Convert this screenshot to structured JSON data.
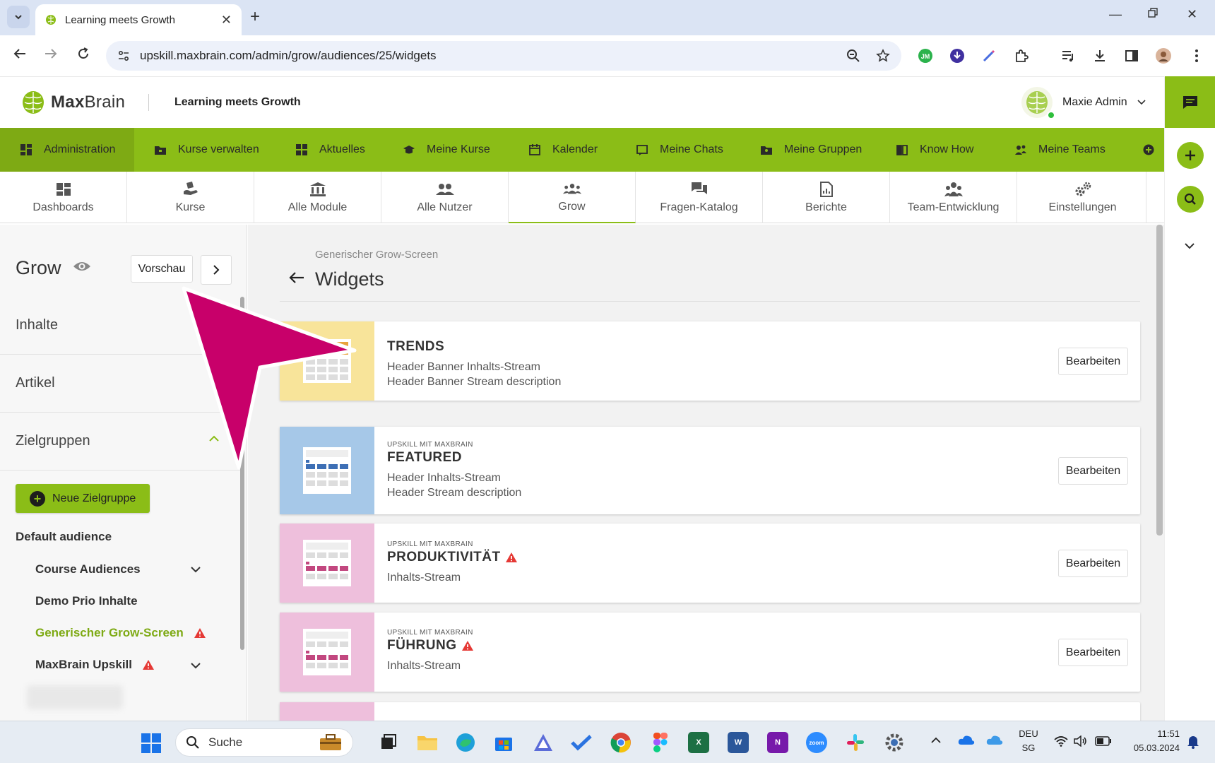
{
  "browser": {
    "tab_title": "Learning meets Growth",
    "url": "upskill.maxbrain.com/admin/grow/audiences/25/widgets"
  },
  "header": {
    "brand_max": "Max",
    "brand_brain": "Brain",
    "tagline": "Learning meets Growth",
    "user_name": "Maxie Admin"
  },
  "main_nav": {
    "items": [
      {
        "label": "Administration",
        "icon": "dashboard-icon"
      },
      {
        "label": "Kurse verwalten",
        "icon": "folder-icon"
      },
      {
        "label": "Aktuelles",
        "icon": "grid-icon"
      },
      {
        "label": "Meine Kurse",
        "icon": "graduation-cap-icon"
      },
      {
        "label": "Kalender",
        "icon": "calendar-icon"
      },
      {
        "label": "Meine Chats",
        "icon": "chat-icon"
      },
      {
        "label": "Meine Gruppen",
        "icon": "folder-group-icon"
      },
      {
        "label": "Know How",
        "icon": "book-icon"
      },
      {
        "label": "Meine Teams",
        "icon": "team-icon"
      }
    ]
  },
  "admin_tabs": {
    "items": [
      {
        "label": "Dashboards"
      },
      {
        "label": "Kurse"
      },
      {
        "label": "Alle Module"
      },
      {
        "label": "Alle Nutzer"
      },
      {
        "label": "Grow"
      },
      {
        "label": "Fragen-Katalog"
      },
      {
        "label": "Berichte"
      },
      {
        "label": "Team-Entwicklung"
      },
      {
        "label": "Einstellungen"
      }
    ],
    "active": "Grow"
  },
  "sidebar": {
    "title": "Grow",
    "preview_label": "Vorschau",
    "sections": [
      "Inhalte",
      "Artikel",
      "Zielgruppen"
    ],
    "new_group_label": "Neue Zielgruppe",
    "default_audience": "Default audience",
    "audiences": [
      {
        "label": "Course Audiences"
      },
      {
        "label": "Demo Prio Inhalte"
      },
      {
        "label": "Generischer Grow-Screen"
      },
      {
        "label": "MaxBrain Upskill"
      }
    ]
  },
  "main": {
    "breadcrumb": "Generischer Grow-Screen",
    "title": "Widgets",
    "edit_label": "Bearbeiten",
    "widgets": [
      {
        "eyebrow": "",
        "title": "TRENDS",
        "lines": [
          "Header Banner Inhalts-Stream",
          "Header Banner Stream description"
        ],
        "thumb_color": "#f8e49a",
        "accent": "#e8a33c",
        "warning": false
      },
      {
        "eyebrow": "UPSKILL MIT MAXBRAIN",
        "title": "FEATURED",
        "lines": [
          "Header Inhalts-Stream",
          "Header Stream description"
        ],
        "thumb_color": "#a6c8e8",
        "accent": "#3d6fb5",
        "warning": false
      },
      {
        "eyebrow": "UPSKILL MIT MAXBRAIN",
        "title": "PRODUKTIVITÄT",
        "lines": [
          "Inhalts-Stream"
        ],
        "thumb_color": "#eebfdc",
        "accent": "#c2477f",
        "warning": true
      },
      {
        "eyebrow": "UPSKILL MIT MAXBRAIN",
        "title": "FÜHRUNG",
        "lines": [
          "Inhalts-Stream"
        ],
        "thumb_color": "#eebfdc",
        "accent": "#c2477f",
        "warning": true
      }
    ]
  },
  "taskbar": {
    "search_label": "Suche",
    "lang": "DEU",
    "region": "SG",
    "time": "11:51",
    "date": "05.03.2024"
  },
  "colors": {
    "brand_green": "#8bbd17",
    "annotation_magenta": "#c8006a",
    "warning_red": "#e53935"
  }
}
